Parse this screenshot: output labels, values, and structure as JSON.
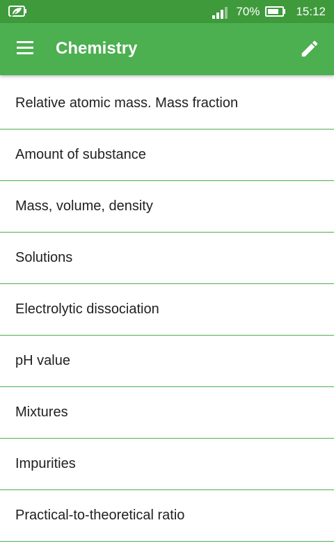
{
  "status_bar": {
    "battery_percent": "70%",
    "time": "15:12",
    "icons": [
      "leaf-battery-saver-icon",
      "signal-icon",
      "battery-icon"
    ]
  },
  "app_bar": {
    "title": "Chemistry",
    "menu_icon": "hamburger-menu-icon",
    "edit_icon": "pencil-edit-icon"
  },
  "topics": [
    {
      "label": "Relative atomic mass. Mass fraction"
    },
    {
      "label": "Amount of substance"
    },
    {
      "label": "Mass, volume, density"
    },
    {
      "label": "Solutions"
    },
    {
      "label": "Electrolytic dissociation"
    },
    {
      "label": "pH value"
    },
    {
      "label": "Mixtures"
    },
    {
      "label": "Impurities"
    },
    {
      "label": "Practical-to-theoretical ratio"
    }
  ],
  "colors": {
    "status_bar": "#3f9a3c",
    "app_bar": "#4caf50",
    "divider": "#4caf50",
    "text": "#212121"
  }
}
